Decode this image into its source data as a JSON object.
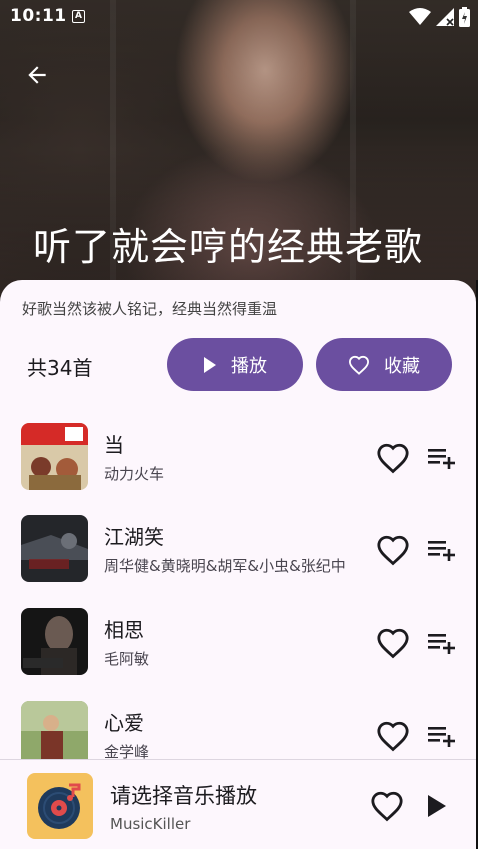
{
  "status_bar": {
    "time": "10:11",
    "notification_badge": "A"
  },
  "header": {
    "title": "听了就会哼的经典老歌"
  },
  "playlist": {
    "description": "好歌当然该被人铭记，经典当然得重温",
    "count_label": "共34首",
    "play_label": "播放",
    "favorite_label": "收藏"
  },
  "songs": [
    {
      "title": "当",
      "artist": "动力火车"
    },
    {
      "title": "江湖笑",
      "artist": "周华健&黄晓明&胡军&小虫&张纪中"
    },
    {
      "title": "相思",
      "artist": "毛阿敏"
    },
    {
      "title": "心爱",
      "artist": "金学峰"
    }
  ],
  "player": {
    "title": "请选择音乐播放",
    "subtitle": "MusicKiller"
  },
  "colors": {
    "accent": "#6b4fa0",
    "sheet": "#fdf7fd",
    "player_cover": "#f4c15d"
  },
  "icons": [
    "back-arrow-icon",
    "play-icon",
    "heart-outline-icon",
    "playlist-add-icon",
    "vinyl-record-icon"
  ]
}
